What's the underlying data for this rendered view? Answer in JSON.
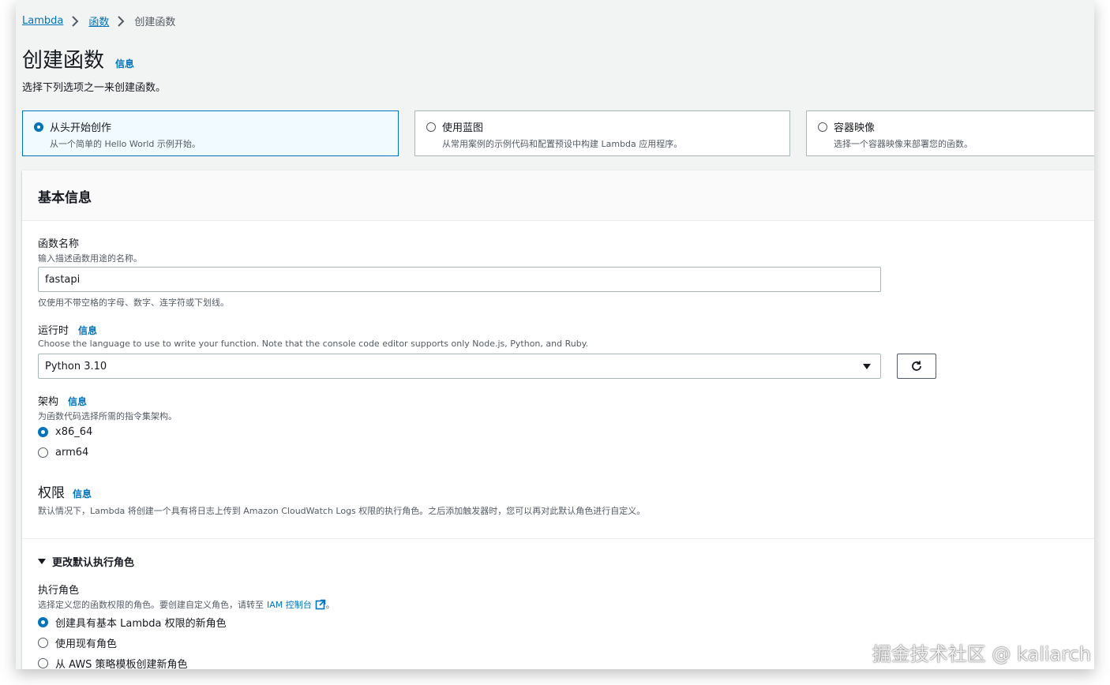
{
  "breadcrumb": {
    "lambda": "Lambda",
    "functions": "函数",
    "current": "创建函数"
  },
  "header": {
    "title": "创建函数",
    "info": "信息",
    "subtitle": "选择下列选项之一来创建函数。"
  },
  "creation_options": [
    {
      "title": "从头开始创作",
      "desc": "从一个简单的 Hello World 示例开始。",
      "selected": true
    },
    {
      "title": "使用蓝图",
      "desc": "从常用案例的示例代码和配置预设中构建 Lambda 应用程序。",
      "selected": false
    },
    {
      "title": "容器映像",
      "desc": "选择一个容器映像来部署您的函数。",
      "selected": false
    }
  ],
  "basic_info": {
    "title": "基本信息",
    "function_name": {
      "label": "函数名称",
      "desc": "输入描述函数用途的名称。",
      "value": "fastapi",
      "hint": "仅使用不带空格的字母、数字、连字符或下划线。"
    },
    "runtime": {
      "label": "运行时",
      "info": "信息",
      "desc": "Choose the language to use to write your function. Note that the console code editor supports only Node.js, Python, and Ruby.",
      "value": "Python 3.10"
    },
    "architecture": {
      "label": "架构",
      "info": "信息",
      "desc": "为函数代码选择所需的指令集架构。",
      "options": [
        "x86_64",
        "arm64"
      ],
      "selected": "x86_64"
    },
    "permissions": {
      "title": "权限",
      "info": "信息",
      "desc": "默认情况下，Lambda 将创建一个具有将日志上传到 Amazon CloudWatch Logs 权限的执行角色。之后添加触发器时，您可以再对此默认角色进行自定义。"
    },
    "change_role": {
      "label": "更改默认执行角色"
    },
    "execution_role": {
      "label": "执行角色",
      "desc_prefix": "选择定义您的函数权限的角色。要创建自定义角色，请转至",
      "iam_link": "IAM 控制台",
      "desc_suffix": "。",
      "options": [
        "创建具有基本 Lambda 权限的新角色",
        "使用现有角色",
        "从 AWS 策略模板创建新角色"
      ],
      "selected": "创建具有基本 Lambda 权限的新角色"
    }
  },
  "watermark": "掘金技术社区 @ kaliarch",
  "colors": {
    "link": "#0073bb",
    "selected_bg": "#f1faff",
    "page_bg": "#f2f3f3"
  }
}
